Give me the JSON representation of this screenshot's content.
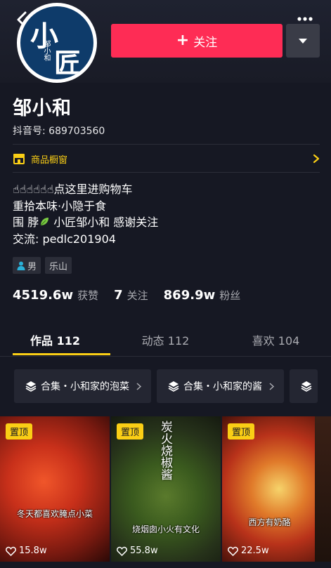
{
  "header": {
    "avatar_text_big1": "小",
    "avatar_text_big2": "匠",
    "avatar_text_small": "邹小和",
    "follow_label": "关注"
  },
  "profile": {
    "name": "邹小和",
    "douyin_id": "抖音号: 689703560",
    "shop_label": "商品橱窗",
    "bio": [
      "☝☝☝☝☝☝点这里进购物车",
      "重拾本味·小隐于食",
      "小匠邹小和 感谢关注",
      "交流: pedlc201904"
    ],
    "bio_line3_prefix": "围 脖",
    "tags": [
      "男",
      "乐山"
    ]
  },
  "stats": [
    {
      "num": "4519.6w",
      "label": "获赞"
    },
    {
      "num": "7",
      "label": "关注"
    },
    {
      "num": "869.9w",
      "label": "粉丝"
    }
  ],
  "tabs": [
    {
      "label": "作品 112",
      "active": true
    },
    {
      "label": "动态 112",
      "active": false
    },
    {
      "label": "喜欢 104",
      "active": false
    }
  ],
  "collections": [
    "合集・小和家的泡菜",
    "合集・小和家的酱"
  ],
  "videos": [
    {
      "pin": "置顶",
      "caption": "冬天都喜欢腌点小菜",
      "likes": "15.8w"
    },
    {
      "pin": "置顶",
      "caption_vertical": "炭火烧椒酱",
      "caption": "烧烟囱小火有文化",
      "likes": "55.8w"
    },
    {
      "pin": "置顶",
      "caption": "西方有奶酪",
      "likes": "22.5w"
    }
  ],
  "colors": {
    "background": "#161823",
    "accent_red": "#fe2c55",
    "accent_yellow": "#face15"
  }
}
